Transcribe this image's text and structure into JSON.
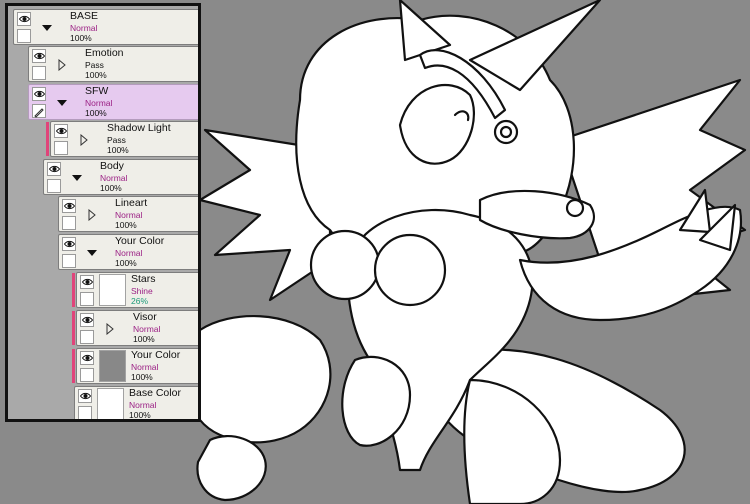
{
  "layers": [
    {
      "name": "BASE",
      "mode": "Normal",
      "opacity": "100%",
      "type": "folder",
      "expanded": true,
      "selected": false
    },
    {
      "name": "Emotion",
      "mode": "Pass",
      "opacity": "100%",
      "type": "folder",
      "expanded": false,
      "selected": false
    },
    {
      "name": "SFW",
      "mode": "Normal",
      "opacity": "100%",
      "type": "folder",
      "expanded": true,
      "selected": true
    },
    {
      "name": "Shadow Light",
      "mode": "Pass",
      "opacity": "100%",
      "type": "folder",
      "expanded": false,
      "selected": false
    },
    {
      "name": "Body",
      "mode": "Normal",
      "opacity": "100%",
      "type": "folder",
      "expanded": true,
      "selected": false
    },
    {
      "name": "Lineart",
      "mode": "Normal",
      "opacity": "100%",
      "type": "folder",
      "expanded": false,
      "selected": false
    },
    {
      "name": "Your Color",
      "mode": "Normal",
      "opacity": "100%",
      "type": "folder",
      "expanded": true,
      "selected": false
    },
    {
      "name": "Stars",
      "mode": "Shine",
      "opacity": "26%",
      "type": "layer",
      "selected": false
    },
    {
      "name": "Visor",
      "mode": "Normal",
      "opacity": "100%",
      "type": "folder",
      "expanded": false,
      "selected": false
    },
    {
      "name": "Your Color",
      "mode": "Normal",
      "opacity": "100%",
      "type": "layer",
      "selected": false
    },
    {
      "name": "Base Color",
      "mode": "Normal",
      "opacity": "100%",
      "type": "layer",
      "selected": false
    }
  ],
  "colors": {
    "canvas_bg": "#8a8a8a",
    "panel_bg": "#a9a9a9",
    "selected_layer": "#e6caef",
    "clipping_indicator": "#e0447a",
    "blend_mode_text": "#9b1f84",
    "opacity_shine_text": "#1d9b7a"
  }
}
